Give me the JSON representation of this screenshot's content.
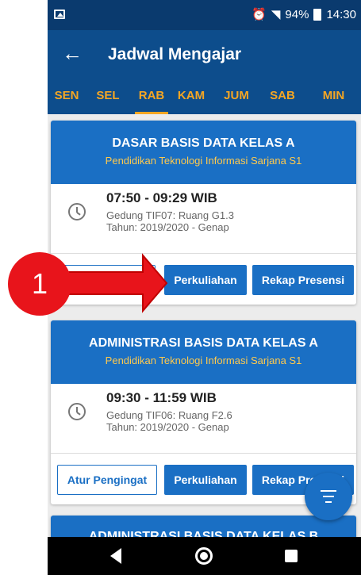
{
  "status_bar": {
    "battery": "94%",
    "time": "14:30"
  },
  "app_bar": {
    "title": "Jadwal Mengajar"
  },
  "tabs": [
    "SEN",
    "SEL",
    "RAB",
    "KAM",
    "JUM",
    "SAB",
    "MIN"
  ],
  "active_tab": "RAB",
  "cards": [
    {
      "title": "DASAR BASIS DATA KELAS A",
      "program": "Pendidikan Teknologi Informasi Sarjana S1",
      "time": "07:50 - 09:29 WIB",
      "room": "Gedung TIF07: Ruang G1.3",
      "year": "Tahun: 2019/2020 - Genap",
      "btn_perkuliahan": "Perkuliahan",
      "btn_rekap": "Rekap Presensi"
    },
    {
      "title": "ADMINISTRASI BASIS DATA KELAS A",
      "program": "Pendidikan Teknologi Informasi Sarjana S1",
      "time": "09:30 - 11:59 WIB",
      "room": "Gedung TIF06: Ruang F2.6",
      "year": "Tahun: 2019/2020 - Genap",
      "btn_pengingat": "Atur Pengingat",
      "btn_perkuliahan": "Perkuliahan",
      "btn_rekap": "Rekap Presensi"
    },
    {
      "title": "ADMINISTRASI BASIS DATA KELAS B"
    }
  ],
  "annotation": {
    "number": "1"
  },
  "colors": {
    "primary": "#1a6fc4",
    "appbar": "#0d4d8c",
    "accent": "#f5a623",
    "marker": "#e8141b"
  }
}
